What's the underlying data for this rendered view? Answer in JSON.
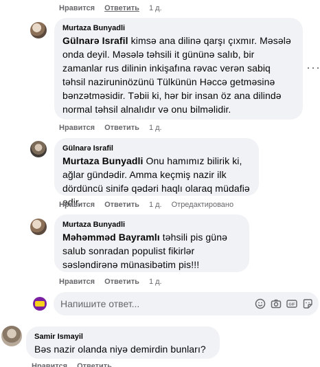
{
  "labels": {
    "like": "Нравится",
    "reply": "Ответить",
    "edited": "Отредактировано",
    "more": "···"
  },
  "top_actions": {
    "time": "1 д."
  },
  "comments": [
    {
      "author": "Murtaza Bunyadli",
      "mention": "Gülnarə Israfil",
      "text": " kimsə ana dilinə qarşı çıxmır. Məsələ onda deyil. Məsələ təhsili it gününə salıb, bir zamanlar rus dilinin inkişafına rəvac verən sabiq təhsil naziruninözünü Tülkünün Həccə getməsinə bənzətməsidir. Təbii ki, hər bir insan öz ana dilində normal təhsil alnalıdır və onu bilməlidir.",
      "time": "1 д."
    },
    {
      "author": "Gülnarə Israfil",
      "mention": "Murtaza Bunyadli",
      "text": " Onu hamımız bilirik ki, ağlar gündədir. Amma keçmiş nazir ilk dördüncü sinifə qədəri haqlı olaraq müdafiə edir.",
      "time": "1 д.",
      "edited": true
    },
    {
      "author": "Murtaza Bunyadli",
      "mention": "Məhəmməd Bayramlı",
      "text": " təhsili pis günə salub sonradan populist fikirlər səsləndirənə münasibətim pis!!!",
      "time": "1 д."
    }
  ],
  "reply_box": {
    "placeholder": "Напишите ответ..."
  },
  "bottom_comment": {
    "author": "Samir Ismayil",
    "text": "Bəs nazir olanda niyə demirdin bunları?"
  },
  "icons": [
    "emoji-icon",
    "camera-icon",
    "gif-icon",
    "sticker-icon"
  ]
}
